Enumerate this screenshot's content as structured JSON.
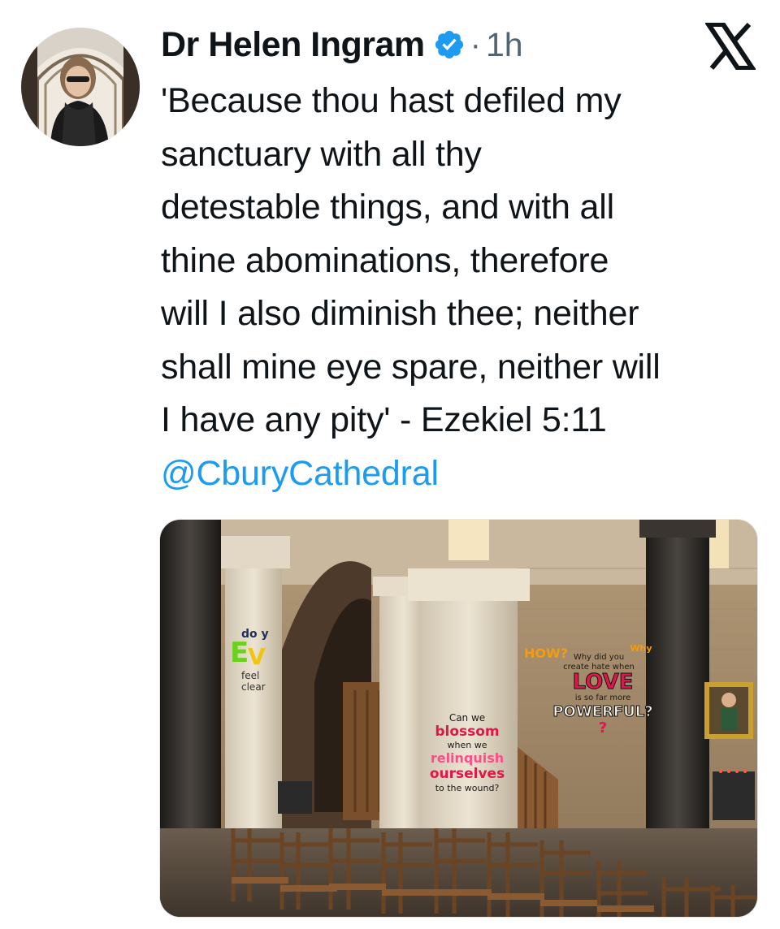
{
  "tweet": {
    "author_name": "Dr Helen Ingram",
    "separator": "·",
    "time": "1h",
    "verified": true,
    "text_lines": [
      "'Because thou hast defiled my",
      "sanctuary with all thy",
      "detestable things, and with all",
      "thine abominations, therefore",
      "will I also diminish thee; neither",
      "shall mine eye spare, neither will",
      "I have any pity' - Ezekiel 5:11"
    ],
    "mention": "@CburyCathedral"
  },
  "icons": {
    "avatar": "profile-photo",
    "verified": "verified-badge-icon",
    "logo": "x-logo-icon"
  },
  "media": {
    "description_graffiti": {
      "left_pillar": [
        "do y",
        "E",
        "feel",
        "clear"
      ],
      "center_pillar": [
        "Can we",
        "blossom",
        "when we",
        "relinquish",
        "ourselves",
        "to the wound?"
      ],
      "right_wall": [
        "HOW?",
        "Why did you",
        "create hate when",
        "LOVE",
        "is so far more",
        "POWERFUL?",
        "?",
        "Why"
      ]
    }
  },
  "colors": {
    "text": "#0f1419",
    "secondary": "#536471",
    "link": "#1d9bf0",
    "verified": "#1d9bf0"
  }
}
